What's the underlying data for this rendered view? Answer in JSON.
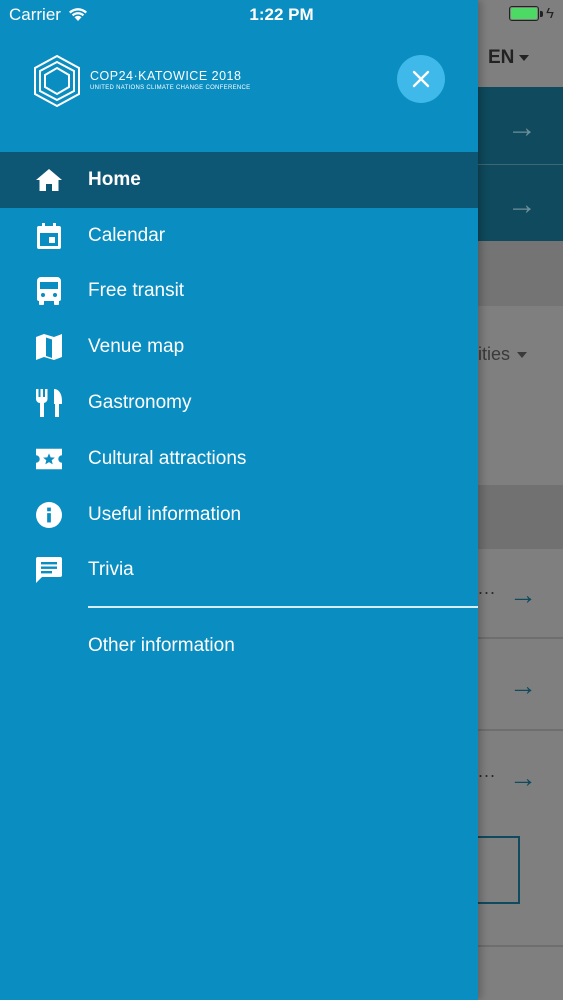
{
  "status_bar": {
    "carrier": "Carrier",
    "time": "1:22 PM"
  },
  "background": {
    "language": "EN",
    "filter_fragment": "ities",
    "dots": "..."
  },
  "drawer": {
    "logo": {
      "title": "COP24·KATOWICE 2018",
      "subtitle": "UNITED NATIONS CLIMATE CHANGE CONFERENCE"
    },
    "menu": [
      {
        "label": "Home",
        "icon": "home-icon",
        "active": true
      },
      {
        "label": "Calendar",
        "icon": "calendar-icon",
        "active": false
      },
      {
        "label": "Free transit",
        "icon": "bus-icon",
        "active": false
      },
      {
        "label": "Venue map",
        "icon": "map-icon",
        "active": false
      },
      {
        "label": "Gastronomy",
        "icon": "cutlery-icon",
        "active": false
      },
      {
        "label": "Cultural attractions",
        "icon": "ticket-icon",
        "active": false
      },
      {
        "label": "Useful information",
        "icon": "info-icon",
        "active": false
      },
      {
        "label": "Trivia",
        "icon": "chat-icon",
        "active": false
      }
    ],
    "other_label": "Other information"
  },
  "colors": {
    "drawer_bg": "#0a8dc0",
    "active_bg": "#0d5674",
    "close_button_bg": "#3fb8ea"
  }
}
